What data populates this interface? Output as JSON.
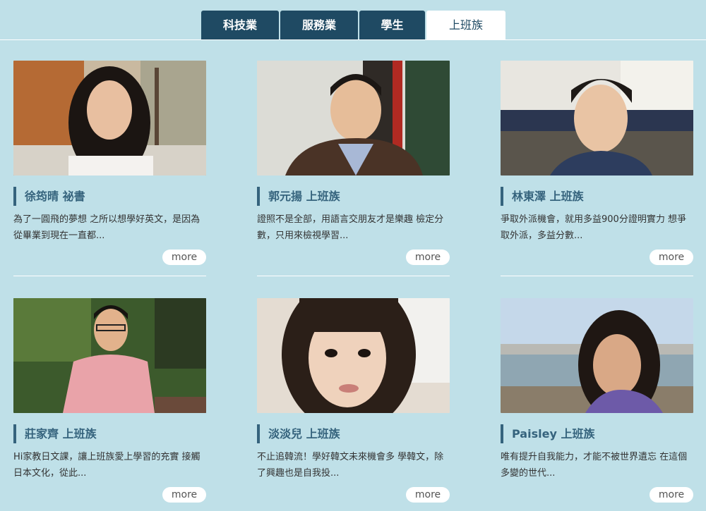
{
  "tabs": [
    {
      "label": "科技業"
    },
    {
      "label": "服務業"
    },
    {
      "label": "學生"
    },
    {
      "label": "上班族"
    }
  ],
  "cards": [
    {
      "name": "徐筠晴 祕書",
      "desc": "為了一圓飛的夢想 之所以想學好英文，是因為從畢業到現在一直都...",
      "more": "more",
      "photo": "woman-autumn-trees-photo"
    },
    {
      "name": "郭元揚 上班族",
      "desc": "證照不是全部，用語言交朋友才是樂趣 檢定分數，只用來檢視學習...",
      "more": "more",
      "photo": "man-temple-photo"
    },
    {
      "name": "林東澤 上班族",
      "desc": "爭取外派機會，就用多益900分證明實力 想爭取外派，多益分數...",
      "more": "more",
      "photo": "man-bus-photo"
    },
    {
      "name": "莊家齊 上班族",
      "desc": "Hi家教日文課，讓上班族愛上學習的充實 接觸日本文化，從此...",
      "more": "more",
      "photo": "man-park-photo"
    },
    {
      "name": "淡淡兒 上班族",
      "desc": "不止追韓流！學好韓文未來機會多 學韓文，除了興趣也是自我投...",
      "more": "more",
      "photo": "woman-selfie-photo"
    },
    {
      "name": "Paisley 上班族",
      "desc": "唯有提升自我能力，才能不被世界遺忘 在這個多變的世代...",
      "more": "more",
      "photo": "woman-riverside-photo"
    }
  ],
  "colors": {
    "background": "#bfe0e8",
    "tab_dark": "#1f4a63",
    "name_accent": "#35637d"
  }
}
